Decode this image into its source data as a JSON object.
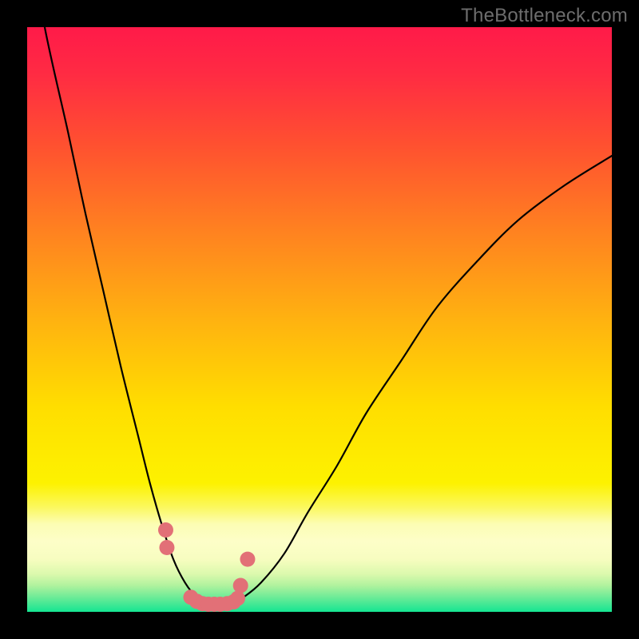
{
  "watermark": "TheBottleneck.com",
  "gradient_stops": [
    {
      "offset": 0.0,
      "color": "#ff1a49"
    },
    {
      "offset": 0.08,
      "color": "#ff2b43"
    },
    {
      "offset": 0.2,
      "color": "#ff5030"
    },
    {
      "offset": 0.35,
      "color": "#ff8220"
    },
    {
      "offset": 0.5,
      "color": "#ffb210"
    },
    {
      "offset": 0.65,
      "color": "#ffde00"
    },
    {
      "offset": 0.78,
      "color": "#fdf200"
    },
    {
      "offset": 0.82,
      "color": "#fbf85c"
    },
    {
      "offset": 0.85,
      "color": "#fcfdb4"
    },
    {
      "offset": 0.88,
      "color": "#fdfec8"
    },
    {
      "offset": 0.91,
      "color": "#f7fdc0"
    },
    {
      "offset": 0.935,
      "color": "#dcf9ad"
    },
    {
      "offset": 0.955,
      "color": "#b0f29e"
    },
    {
      "offset": 0.975,
      "color": "#6deb97"
    },
    {
      "offset": 1.0,
      "color": "#15e592"
    }
  ],
  "chart_data": {
    "type": "line",
    "title": "",
    "xlabel": "",
    "ylabel": "",
    "xlim": [
      0,
      100
    ],
    "ylim": [
      0,
      100
    ],
    "series": [
      {
        "name": "curve",
        "x": [
          0,
          3,
          7,
          10,
          13,
          16,
          19,
          21,
          23,
          25,
          27,
          29,
          31,
          33,
          35,
          37,
          40,
          44,
          48,
          53,
          58,
          64,
          70,
          77,
          84,
          92,
          100
        ],
        "y": [
          118,
          100,
          82,
          68,
          55,
          42,
          30,
          22,
          15,
          9,
          5,
          2.5,
          1.5,
          1.3,
          1.5,
          2.5,
          5,
          10,
          17,
          25,
          34,
          43,
          52,
          60,
          67,
          73,
          78
        ]
      }
    ],
    "marker_cluster": {
      "name": "markers",
      "x": [
        23.7,
        23.9,
        28.0,
        29.0,
        30.0,
        31.0,
        32.0,
        33.0,
        34.2,
        35.3,
        36.0,
        36.5,
        37.7
      ],
      "y": [
        14.0,
        11.0,
        2.5,
        1.8,
        1.4,
        1.3,
        1.3,
        1.3,
        1.4,
        1.7,
        2.3,
        4.5,
        9.0
      ]
    },
    "marker_color": "#e27077",
    "curve_color": "#000000"
  }
}
